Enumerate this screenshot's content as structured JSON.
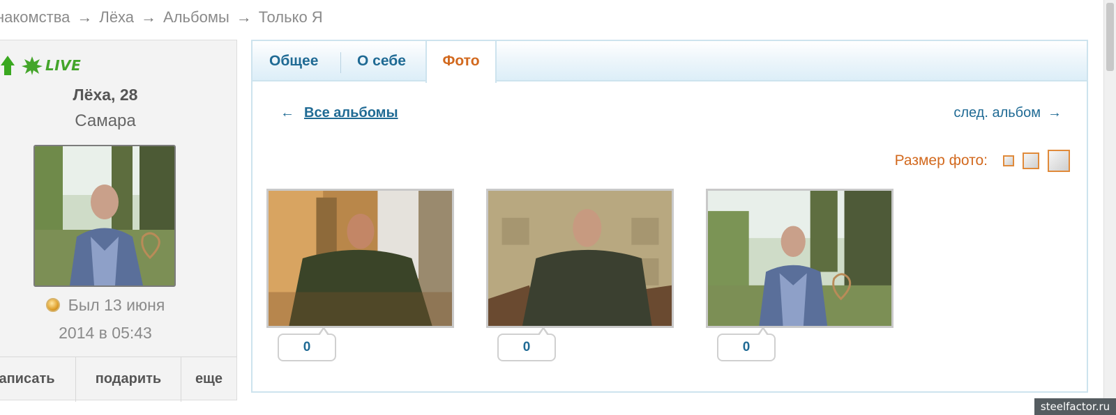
{
  "breadcrumb": {
    "items": [
      "накомства",
      "Лёха",
      "Альбомы",
      "Только Я"
    ],
    "separator": "→"
  },
  "profile": {
    "live_label": "LIVE",
    "name": "Лёха, 28",
    "city": "Самара",
    "last_seen_line1": "Был 13 июня",
    "last_seen_line2": "2014 в 05:43",
    "actions": [
      "аписать",
      "подарить",
      "еще"
    ]
  },
  "tabs": {
    "general": "Общее",
    "about": "О себе",
    "photo": "Фото"
  },
  "album_nav": {
    "back_arrow": "←",
    "back_label": "Все альбомы",
    "next_label": "след. альбом",
    "next_arrow": "→"
  },
  "photo_size": {
    "label": "Размер фото:"
  },
  "photos": [
    {
      "comments": "0"
    },
    {
      "comments": "0"
    },
    {
      "comments": "0"
    }
  ],
  "watermark": "steelfactor.ru",
  "colors": {
    "link": "#1f6a94",
    "active_tab": "#d2691e",
    "live_green": "#44a52a"
  }
}
